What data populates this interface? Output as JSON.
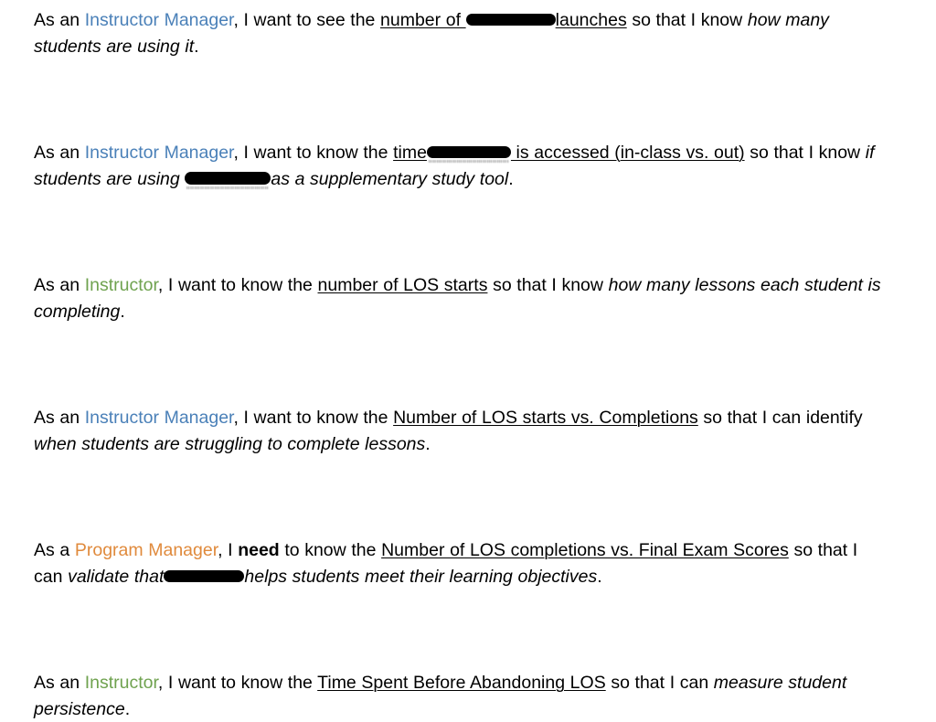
{
  "document": {
    "type": "user-stories-list",
    "background_color": "#ffffff",
    "text_color": "#000000",
    "role_colors": {
      "instructor_manager": "#4a80b8",
      "instructor": "#6fa24f",
      "program_manager": "#e08a3c"
    },
    "redaction_color": "#000000"
  },
  "stories": [
    {
      "id": "story-1",
      "lead": "As an ",
      "role": "Instructor Manager",
      "role_color_key": "instructor_manager",
      "connector": ", I want to see the ",
      "metric_pre": "number of ",
      "redacted": true,
      "metric_post": "launches",
      "purpose_connector": " so that I know ",
      "outcome": "how many students are using it",
      "end": "."
    },
    {
      "id": "story-2",
      "lead": "As an ",
      "role": "Instructor Manager",
      "role_color_key": "instructor_manager",
      "connector": ", I want to know the ",
      "metric_pre": "time",
      "redacted": true,
      "metric_post": " is accessed (in-class vs. out)",
      "purpose_connector": " so that I know ",
      "outcome_pre": "if students are using ",
      "outcome_redacted": true,
      "outcome_post": "as a supplementary study tool",
      "end": "."
    },
    {
      "id": "story-3",
      "lead": "As an ",
      "role": "Instructor",
      "role_color_key": "instructor",
      "connector": ", I want to know the ",
      "metric": "number of LOS starts",
      "purpose_connector": " so that I know ",
      "outcome": "how many lessons each student is completing",
      "end": "."
    },
    {
      "id": "story-4",
      "lead": "As an ",
      "role": "Instructor Manager",
      "role_color_key": "instructor_manager",
      "connector": ", I want to know the ",
      "metric": "Number of LOS starts vs. Completions",
      "purpose_connector": " so that I can identify ",
      "outcome": "when students are struggling to complete lessons",
      "end": "."
    },
    {
      "id": "story-5",
      "lead": "As a ",
      "role": "Program Manager",
      "role_color_key": "program_manager",
      "connector_a": ", I ",
      "emphasis": "need",
      "connector_b": " to know the ",
      "metric": "Number of LOS completions vs. Final Exam Scores",
      "purpose_connector": " so that I can ",
      "outcome_pre": "validate that",
      "outcome_redacted": true,
      "outcome_post": "helps students meet their learning objectives",
      "end": "."
    },
    {
      "id": "story-6",
      "lead": "As an ",
      "role": "Instructor",
      "role_color_key": "instructor",
      "connector": ", I want to know the ",
      "metric": "Time Spent Before Abandoning LOS",
      "purpose_connector": " so that I can ",
      "outcome": "measure student persistence",
      "end": "."
    }
  ]
}
